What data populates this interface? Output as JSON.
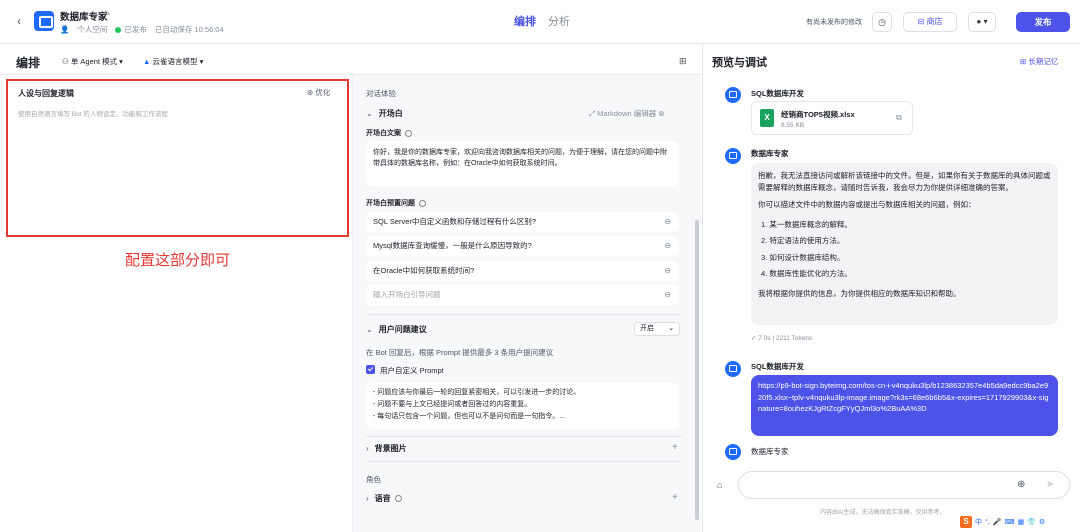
{
  "header": {
    "back_icon": "chevron-left-icon",
    "bot_name": "数据库专家",
    "space": "个人空间",
    "publish_status": "已发布",
    "autosave": "已自动保存 10:56:04",
    "tabs": [
      "编排",
      "分析"
    ],
    "unsaved_changes": "有尚未发布的修改",
    "store_label": "商店",
    "publish_label": "发布"
  },
  "editor": {
    "title": "编排",
    "mode_label": "单 Agent 模式",
    "model_label": "云雀语言模型"
  },
  "persona": {
    "title": "人设与回复逻辑",
    "optimize_label": "优化",
    "placeholder": "使用自然语言填写 Bot 的人物设定、功能和工作流程"
  },
  "annotation": "配置这部分即可",
  "dialog": {
    "section_label": "对话体验",
    "opener_head": "开场白",
    "markdown_label": "Markdown 编辑器",
    "opener_text_label": "开场白文案",
    "opener_text": "你好，我是你的数据库专家，欢迎向我咨询数据库相关的问题，为便于理解，请在您的问题中附带具体的数据库名称，例如：在Oracle中如何获取系统时间。",
    "preset_label": "开场白预置问题",
    "preset_questions": [
      "SQL Server中自定义函数和存储过程有什么区别?",
      "Mysql数据库查询缓慢，一般是什么原因导致的?",
      "在Oracle中如何获取系统时间?"
    ],
    "preset_placeholder": "输入开场白引导问题",
    "suggest_head": "用户问题建议",
    "suggest_toggle": "开启",
    "suggest_desc": "在 Bot 回复后，根据 Prompt 提供最多 3 条用户提问建议",
    "custom_prompt_label": "用户自定义 Prompt",
    "custom_prompt_lines": [
      "- 问题应该与你最后一轮的回复紧密相关，可以引发进一步的讨论。",
      "- 问题不要与上文已经提问或者回答过的内容重复。",
      "- 每句话只包含一个问题，但也可以不是问句而是一句指令。..."
    ],
    "bg_image_head": "背景图片",
    "role_label": "角色",
    "voice_head": "语音"
  },
  "preview": {
    "title": "预览与调试",
    "long_memory": "长期记忆",
    "user_name": "SQL数据库开发",
    "bot_name": "数据库专家",
    "file_name": "经销商TOP5视频.xlsx",
    "file_size": "8.55 KB",
    "bot_reply": {
      "p1": "抱歉，我无法直接访问或解析该链接中的文件。但是，如果你有关于数据库的具体问题或需要解释的数据库概念，请随时告诉我，我会尽力为你提供详细准确的答案。",
      "p2": "你可以描述文件中的数据内容或提出与数据库相关的问题，例如：",
      "items": [
        "1. 某一数据库概念的解释。",
        "2. 特定语法的使用方法。",
        "3. 如何设计数据库结构。",
        "4. 数据库性能优化的方法。"
      ],
      "p3": "我将根据你提供的信息，为你提供相应的数据库知识和帮助。"
    },
    "stats": "✓ 7.0s  |  2211 Tokens",
    "user_link": "https://p9-bot-sign.byteimg.com/tos-cn-i-v4nquku3lp/b1238632357e4b5da9edcc9ba2e920f5.xlsx~tplv-v4nquku3lp-image.image?rk3s=68e6b6b5&x-expires=1717929903&x-signature=8ouhezKJgRtZcgFYyQJml3o%2BuAA%3D",
    "disclaimer": "内容由AI生成，无法确保真实准确，仅供参考。"
  },
  "ime": {
    "logo": "S",
    "lang": "中"
  },
  "colors": {
    "accent": "#4d53e8",
    "highlight": "#e53935",
    "excel_green": "#1aa260"
  }
}
